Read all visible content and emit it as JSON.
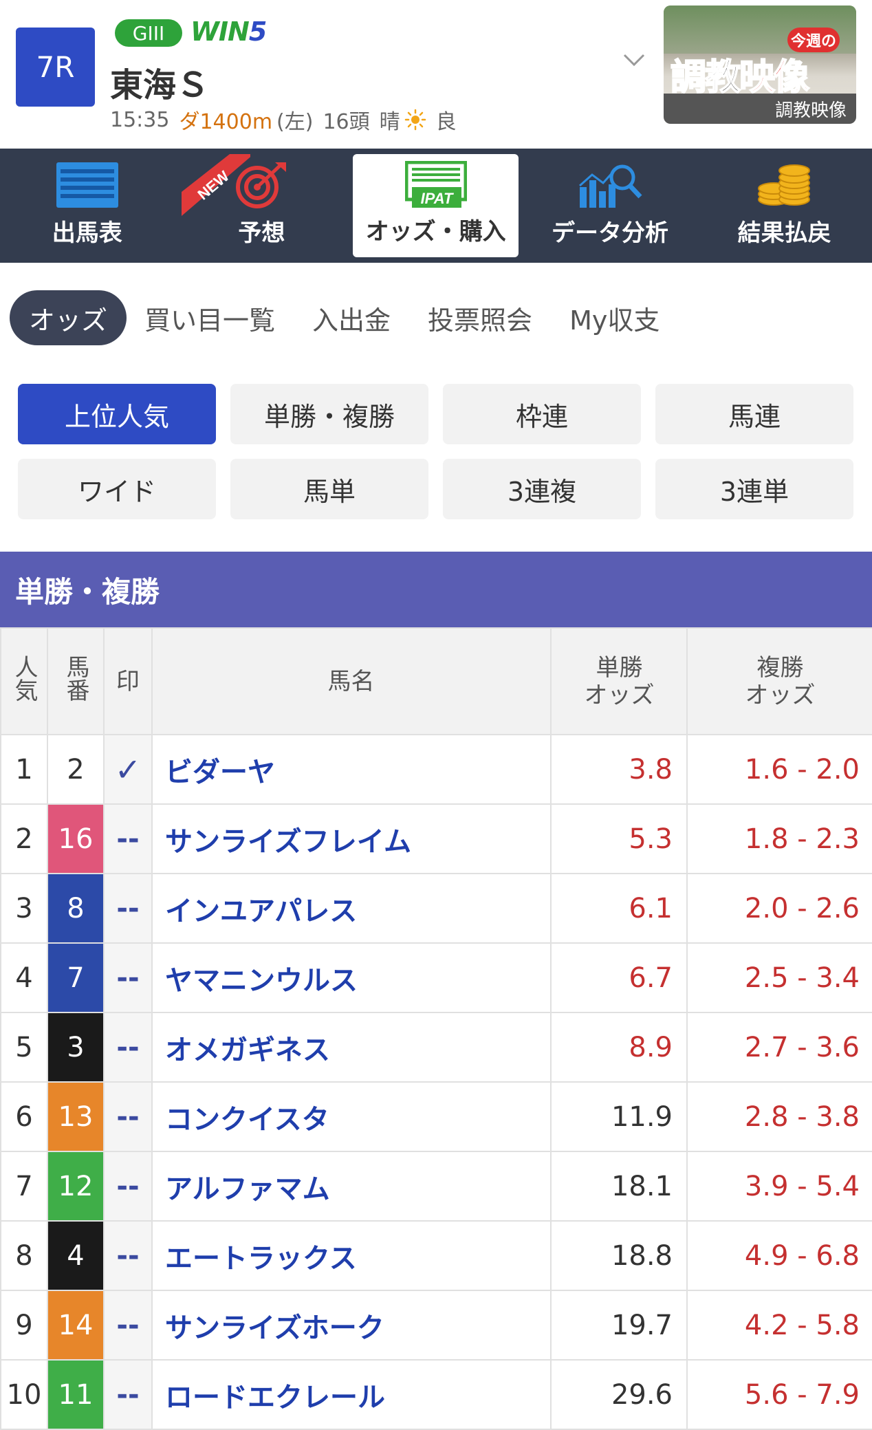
{
  "race": {
    "number": "7R",
    "grade": "GIII",
    "win5_a": "WIN",
    "win5_b": "5",
    "name": "東海Ｓ",
    "time": "15:35",
    "course": "ダ1400m",
    "direction": "(左)",
    "runners": "16頭",
    "weather": "晴",
    "track_condition": "良"
  },
  "training_banner": {
    "badge": "今週の",
    "title_a": "調",
    "title_b": "教",
    "title_c": "映像",
    "caption": "調教映像"
  },
  "main_nav": [
    {
      "label": "出馬表",
      "icon": "racecard-icon"
    },
    {
      "label": "予想",
      "icon": "target-icon",
      "badge": "NEW"
    },
    {
      "label": "オッズ・購入",
      "icon": "ipat-icon",
      "icon_text": "IPAT"
    },
    {
      "label": "データ分析",
      "icon": "chart-search-icon"
    },
    {
      "label": "結果払戻",
      "icon": "coins-icon"
    }
  ],
  "sub_tabs": [
    "オッズ",
    "買い目一覧",
    "入出金",
    "投票照会",
    "My収支"
  ],
  "bet_types": [
    "上位人気",
    "単勝・複勝",
    "枠連",
    "馬連",
    "ワイド",
    "馬単",
    "3連複",
    "3連単"
  ],
  "section_title": "単勝・複勝",
  "table_headers": {
    "popularity": "人気",
    "horse_number": "馬番",
    "mark": "印",
    "horse_name": "馬名",
    "win_odds_a": "単勝",
    "win_odds_b": "オッズ",
    "place_odds_a": "複勝",
    "place_odds_b": "オッズ"
  },
  "rows": [
    {
      "pop": "1",
      "num": "2",
      "mark": "✓",
      "name": "ビダーヤ",
      "win": "3.8",
      "place": "1.6 - 2.0",
      "frame_color": "#ffffff",
      "num_color": "#333333",
      "win_hot": true
    },
    {
      "pop": "2",
      "num": "16",
      "mark": "--",
      "name": "サンライズフレイム",
      "win": "5.3",
      "place": "1.8 - 2.3",
      "frame_color": "#e0567a",
      "num_color": "#ffffff",
      "win_hot": true
    },
    {
      "pop": "3",
      "num": "8",
      "mark": "--",
      "name": "インユアパレス",
      "win": "6.1",
      "place": "2.0 - 2.6",
      "frame_color": "#2c4aa8",
      "num_color": "#ffffff",
      "win_hot": true
    },
    {
      "pop": "4",
      "num": "7",
      "mark": "--",
      "name": "ヤマニンウルス",
      "win": "6.7",
      "place": "2.5 - 3.4",
      "frame_color": "#2c4aa8",
      "num_color": "#ffffff",
      "win_hot": true
    },
    {
      "pop": "5",
      "num": "3",
      "mark": "--",
      "name": "オメガギネス",
      "win": "8.9",
      "place": "2.7 - 3.6",
      "frame_color": "#1a1a1a",
      "num_color": "#ffffff",
      "win_hot": true
    },
    {
      "pop": "6",
      "num": "13",
      "mark": "--",
      "name": "コンクイスタ",
      "win": "11.9",
      "place": "2.8 - 3.8",
      "frame_color": "#e7862a",
      "num_color": "#ffffff",
      "win_hot": false
    },
    {
      "pop": "7",
      "num": "12",
      "mark": "--",
      "name": "アルファマム",
      "win": "18.1",
      "place": "3.9 - 5.4",
      "frame_color": "#3fae48",
      "num_color": "#ffffff",
      "win_hot": false
    },
    {
      "pop": "8",
      "num": "4",
      "mark": "--",
      "name": "エートラックス",
      "win": "18.8",
      "place": "4.9 - 6.8",
      "frame_color": "#1a1a1a",
      "num_color": "#ffffff",
      "win_hot": false
    },
    {
      "pop": "9",
      "num": "14",
      "mark": "--",
      "name": "サンライズホーク",
      "win": "19.7",
      "place": "4.2 - 5.8",
      "frame_color": "#e7862a",
      "num_color": "#ffffff",
      "win_hot": false
    },
    {
      "pop": "10",
      "num": "11",
      "mark": "--",
      "name": "ロードエクレール",
      "win": "29.6",
      "place": "5.6 - 7.9",
      "frame_color": "#3fae48",
      "num_color": "#ffffff",
      "win_hot": false
    }
  ]
}
